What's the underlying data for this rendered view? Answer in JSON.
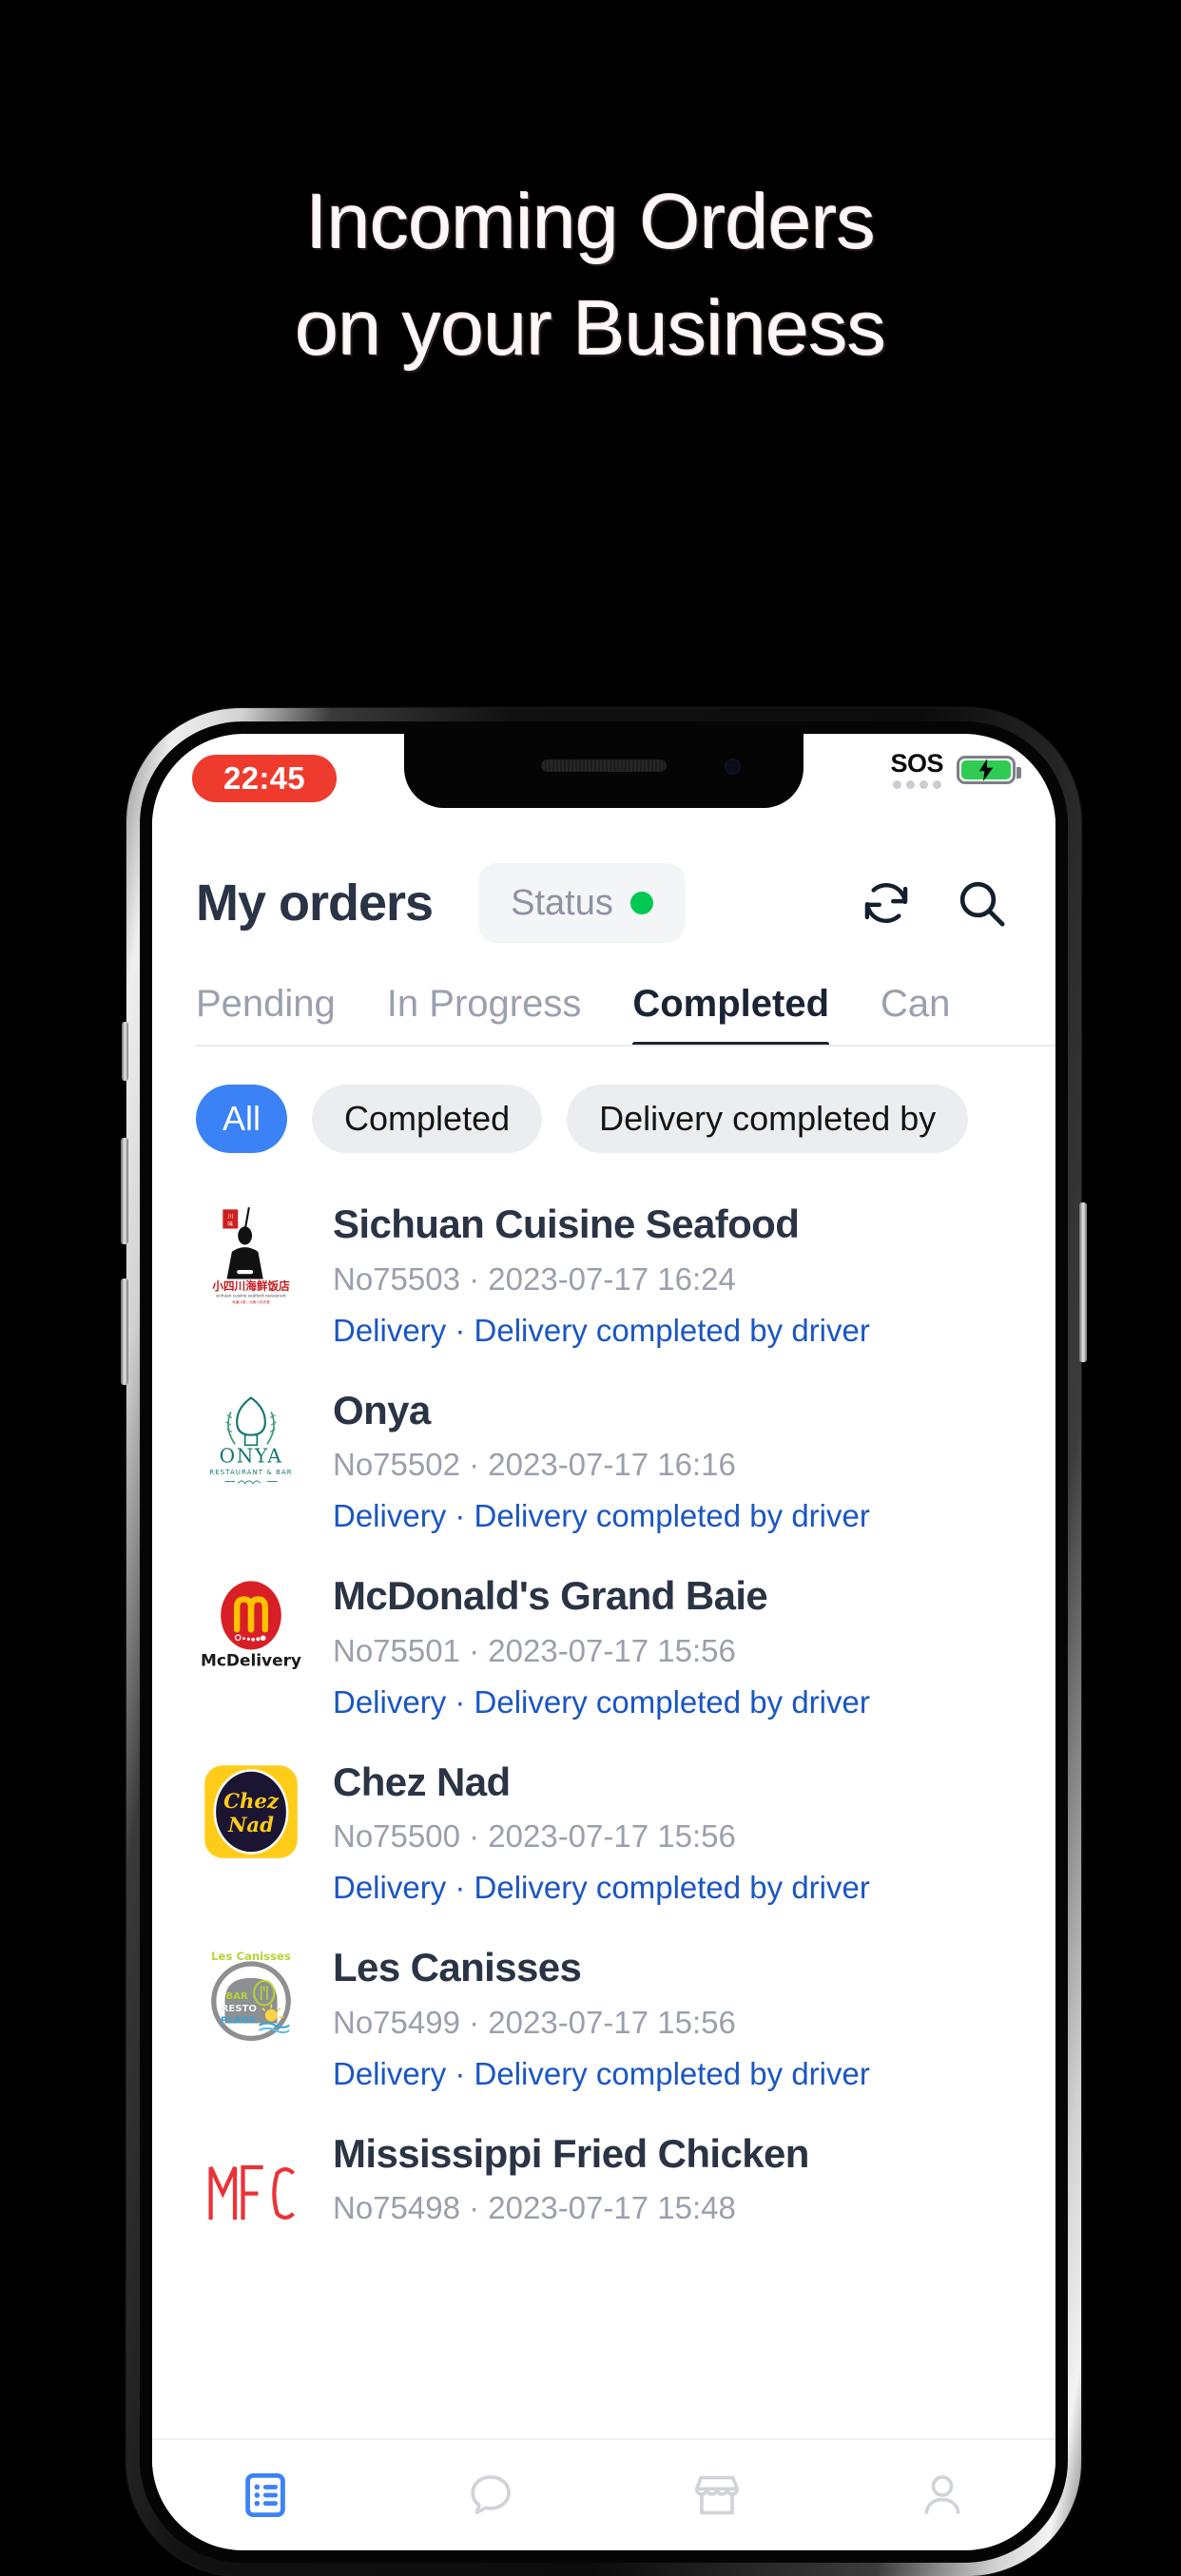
{
  "promo": {
    "line1": "Incoming Orders",
    "line2": "on your Business",
    "text_color": "#fdf7f7",
    "background": "#000000"
  },
  "status_bar": {
    "recording_time": "22:45",
    "recording_pill_color": "#ee3b2e",
    "carrier_status": "SOS",
    "signal_dots": 4,
    "battery_charging": true,
    "battery_color": "#2fcb52"
  },
  "header": {
    "title": "My orders",
    "status_chip": {
      "label": "Status",
      "dot_color": "#00c853"
    },
    "icons": [
      {
        "name": "refresh-icon",
        "label": "Refresh"
      },
      {
        "name": "search-icon",
        "label": "Search"
      }
    ]
  },
  "tabs": {
    "active": "Completed",
    "items": [
      {
        "label": "Pending",
        "active": false
      },
      {
        "label": "In Progress",
        "active": false
      },
      {
        "label": "Completed",
        "active": true
      },
      {
        "label": "Canc",
        "active": false
      }
    ]
  },
  "filters": {
    "active": "All",
    "accent_color": "#3b82f6",
    "items": [
      {
        "label": "All",
        "active": true
      },
      {
        "label": "Completed",
        "active": false
      },
      {
        "label": "Delivery completed by",
        "active": false
      }
    ]
  },
  "orders": {
    "status_link_color": "#1a56c4",
    "items": [
      {
        "name": "Sichuan Cuisine Seafood",
        "meta": "No75503 · 2023-07-17 16:24",
        "status": "Delivery · Delivery completed by driver",
        "logo": "sichuan-cuisine-seafood-logo"
      },
      {
        "name": "Onya",
        "meta": "No75502 · 2023-07-17 16:16",
        "status": "Delivery · Delivery completed by driver",
        "logo": "onya-restaurant-bar-logo"
      },
      {
        "name": "McDonald's Grand Baie",
        "meta": "No75501 · 2023-07-17 15:56",
        "status": "Delivery · Delivery completed by driver",
        "logo": "mcdelivery-logo"
      },
      {
        "name": "Chez Nad",
        "meta": "No75500 · 2023-07-17 15:56",
        "status": "Delivery · Delivery completed by driver",
        "logo": "chez-nad-logo"
      },
      {
        "name": "Les Canisses",
        "meta": "No75499 · 2023-07-17 15:56",
        "status": "Delivery · Delivery completed by driver",
        "logo": "les-canisses-bar-resto-plage-logo"
      },
      {
        "name": "Mississippi Fried Chicken",
        "meta": "No75498 · 2023-07-17 15:48",
        "status": "",
        "logo": "mfc-logo"
      }
    ]
  },
  "bottom_nav": {
    "active_index": 0,
    "active_color": "#3b82f6",
    "items": [
      {
        "name": "orders-icon",
        "label": "Orders"
      },
      {
        "name": "chat-icon",
        "label": "Chat"
      },
      {
        "name": "store-icon",
        "label": "Store"
      },
      {
        "name": "profile-icon",
        "label": "Profile"
      }
    ]
  }
}
